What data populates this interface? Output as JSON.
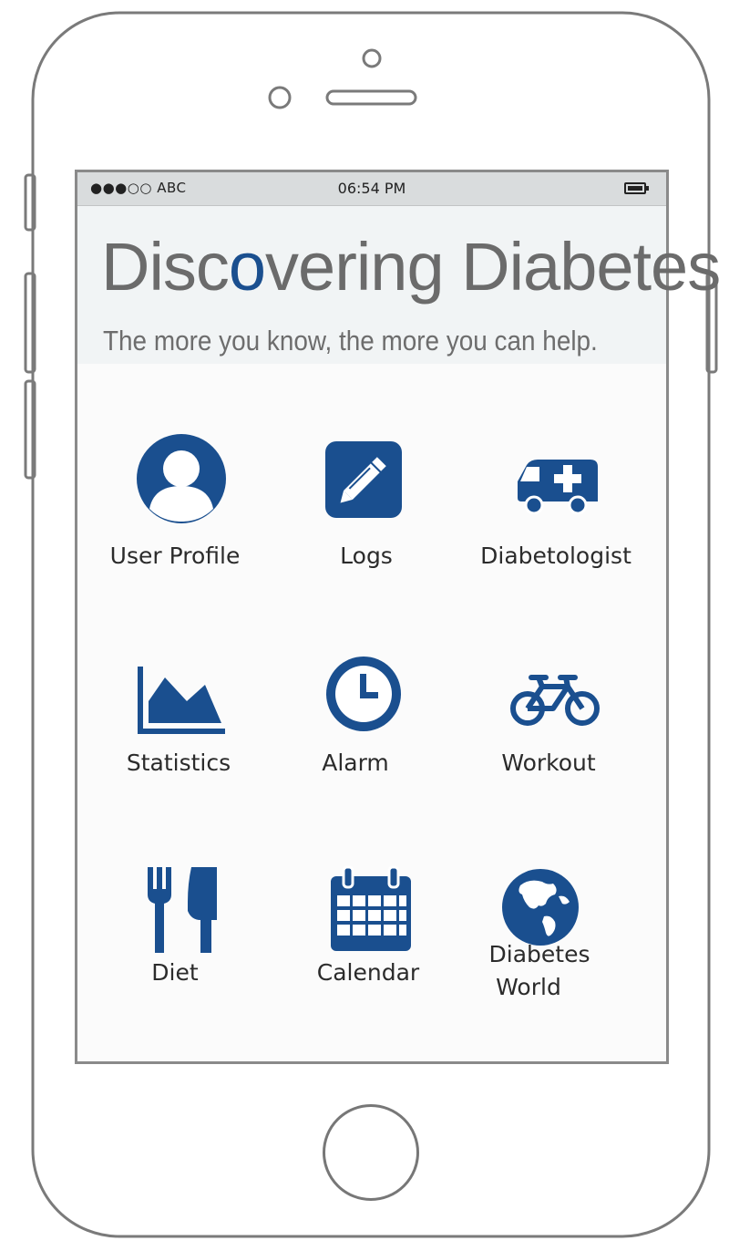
{
  "status_bar": {
    "signal": "●●●○○",
    "carrier": "ABC",
    "time": "06:54 PM"
  },
  "banner": {
    "title_part1": "Disc",
    "title_accent": "o",
    "title_part2": "vering Diabetes",
    "subtitle": "The more you know, the more you can help."
  },
  "tiles": [
    {
      "label": "User Profile",
      "icon": "user-icon"
    },
    {
      "label": "Logs",
      "icon": "pencil-icon"
    },
    {
      "label": "Diabetologist",
      "icon": "ambulance-icon"
    },
    {
      "label": "Statistics",
      "icon": "area-chart-icon"
    },
    {
      "label": "Alarm",
      "icon": "clock-icon"
    },
    {
      "label": "Workout",
      "icon": "bicycle-icon"
    },
    {
      "label": "Diet",
      "icon": "fork-knife-icon"
    },
    {
      "label": "Calendar",
      "icon": "calendar-icon"
    },
    {
      "label_line1": "Diabetes",
      "label_line2": "World",
      "icon": "globe-icon"
    }
  ],
  "colors": {
    "accent": "#1a4f8f",
    "label": "#2b2b2b",
    "banner_bg": "#f1f4f5",
    "status_bg": "#d9dcdd"
  }
}
